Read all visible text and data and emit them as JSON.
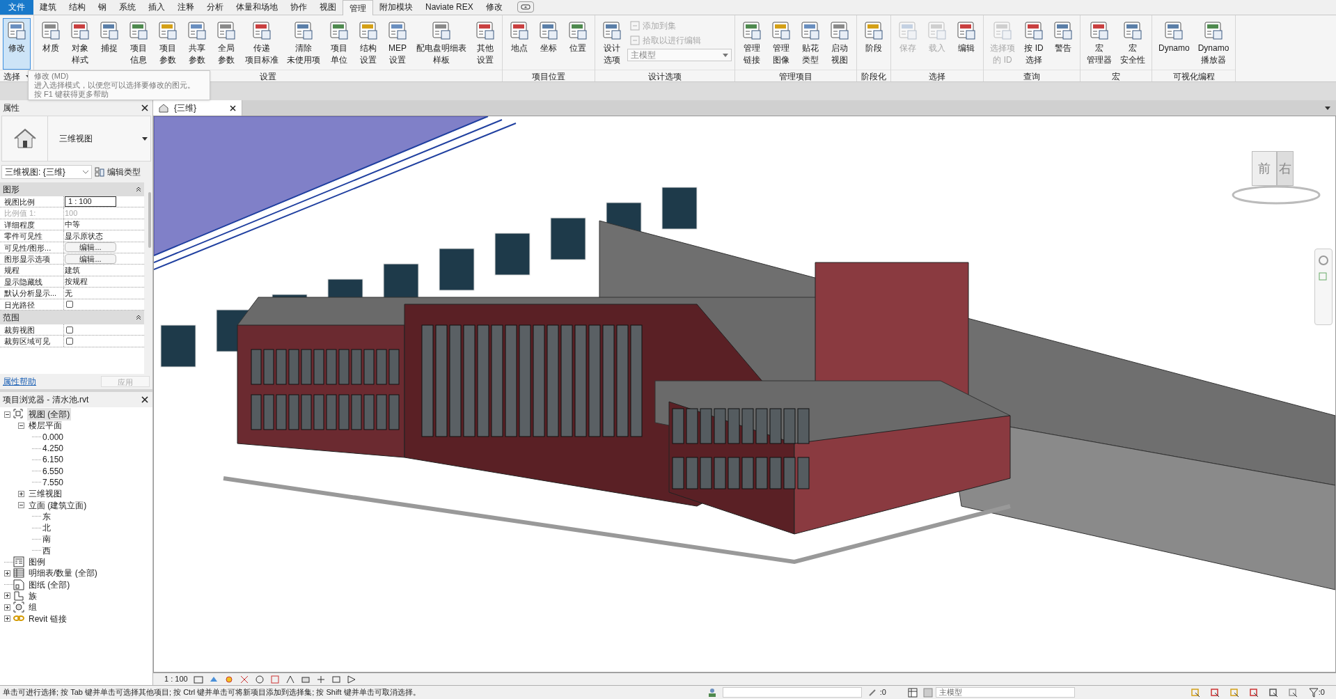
{
  "menu_tabs": [
    {
      "label": "文件",
      "kind": "file",
      "selected": false
    },
    {
      "label": "建筑",
      "kind": "tab",
      "selected": false
    },
    {
      "label": "结构",
      "kind": "tab",
      "selected": false
    },
    {
      "label": "钢",
      "kind": "tab",
      "selected": false
    },
    {
      "label": "系统",
      "kind": "tab",
      "selected": false
    },
    {
      "label": "插入",
      "kind": "tab",
      "selected": false
    },
    {
      "label": "注释",
      "kind": "tab",
      "selected": false
    },
    {
      "label": "分析",
      "kind": "tab",
      "selected": false
    },
    {
      "label": "体量和场地",
      "kind": "tab",
      "selected": false
    },
    {
      "label": "协作",
      "kind": "tab",
      "selected": false
    },
    {
      "label": "视图",
      "kind": "tab",
      "selected": false
    },
    {
      "label": "管理",
      "kind": "tab",
      "selected": true
    },
    {
      "label": "附加模块",
      "kind": "tab",
      "selected": false
    },
    {
      "label": "Naviate REX",
      "kind": "tab",
      "selected": false
    },
    {
      "label": "修改",
      "kind": "tab",
      "selected": false
    }
  ],
  "ribbon_panels": [
    {
      "label": "选择",
      "dropdown": true,
      "buttons": [
        {
          "lines": [
            "修改"
          ],
          "kind": "large",
          "selected": true,
          "disabled": false
        }
      ]
    },
    {
      "label": "设置",
      "dropdown": false,
      "buttons": [
        {
          "lines": [
            "材质"
          ],
          "kind": "large",
          "selected": false,
          "disabled": false
        },
        {
          "lines": [
            "对象",
            "样式"
          ],
          "kind": "large",
          "selected": false,
          "disabled": false
        },
        {
          "lines": [
            "捕捉"
          ],
          "kind": "large",
          "selected": false,
          "disabled": false
        },
        {
          "lines": [
            "项目",
            "信息"
          ],
          "kind": "large",
          "selected": false,
          "disabled": false
        },
        {
          "lines": [
            "项目",
            "参数"
          ],
          "kind": "large",
          "selected": false,
          "disabled": false
        },
        {
          "lines": [
            "共享",
            "参数"
          ],
          "kind": "large",
          "selected": false,
          "disabled": false
        },
        {
          "lines": [
            "全局",
            "参数"
          ],
          "kind": "large",
          "selected": false,
          "disabled": false
        },
        {
          "lines": [
            "传递",
            "项目标准"
          ],
          "kind": "large",
          "selected": false,
          "disabled": false
        },
        {
          "lines": [
            "清除",
            "未使用项"
          ],
          "kind": "large",
          "selected": false,
          "disabled": false
        },
        {
          "lines": [
            "项目",
            "单位"
          ],
          "kind": "large",
          "selected": false,
          "disabled": false
        },
        {
          "lines": [
            "结构",
            "设置"
          ],
          "kind": "large",
          "selected": false,
          "disabled": false
        },
        {
          "lines": [
            "MEP",
            "设置"
          ],
          "kind": "large",
          "selected": false,
          "disabled": false
        },
        {
          "lines": [
            "配电盘明细表",
            "样板"
          ],
          "kind": "large",
          "selected": false,
          "disabled": false
        },
        {
          "lines": [
            "其他",
            "设置"
          ],
          "kind": "large",
          "selected": false,
          "disabled": false
        }
      ]
    },
    {
      "label": "项目位置",
      "dropdown": false,
      "buttons": [
        {
          "lines": [
            "地点"
          ],
          "kind": "large",
          "selected": false,
          "disabled": false
        },
        {
          "lines": [
            "坐标"
          ],
          "kind": "large",
          "selected": false,
          "disabled": false
        },
        {
          "lines": [
            "位置"
          ],
          "kind": "large",
          "selected": false,
          "disabled": false
        }
      ]
    },
    {
      "label": "设计选项",
      "dropdown": false,
      "buttons": [
        {
          "lines": [
            "设计",
            "选项"
          ],
          "kind": "large",
          "selected": false,
          "disabled": false
        },
        {
          "lines": [
            "添加到集"
          ],
          "kind": "small",
          "disabled": true
        },
        {
          "lines": [
            "拾取以进行编辑"
          ],
          "kind": "small",
          "disabled": true
        },
        {
          "lines": [
            "主模型"
          ],
          "kind": "combo"
        }
      ]
    },
    {
      "label": "管理项目",
      "dropdown": false,
      "buttons": [
        {
          "lines": [
            "管理",
            "链接"
          ],
          "kind": "large",
          "selected": false,
          "disabled": false
        },
        {
          "lines": [
            "管理",
            "图像"
          ],
          "kind": "large",
          "selected": false,
          "disabled": false
        },
        {
          "lines": [
            "贴花",
            "类型"
          ],
          "kind": "large",
          "selected": false,
          "disabled": false
        },
        {
          "lines": [
            "启动",
            "视图"
          ],
          "kind": "large",
          "selected": false,
          "disabled": false
        }
      ]
    },
    {
      "label": "阶段化",
      "dropdown": false,
      "buttons": [
        {
          "lines": [
            "阶段"
          ],
          "kind": "large",
          "selected": false,
          "disabled": false
        }
      ]
    },
    {
      "label": "选择",
      "dropdown": false,
      "buttons": [
        {
          "lines": [
            "保存"
          ],
          "kind": "large",
          "selected": false,
          "disabled": true
        },
        {
          "lines": [
            "载入"
          ],
          "kind": "large",
          "selected": false,
          "disabled": true
        },
        {
          "lines": [
            "编辑"
          ],
          "kind": "large",
          "selected": false,
          "disabled": false
        }
      ]
    },
    {
      "label": "查询",
      "dropdown": false,
      "buttons": [
        {
          "lines": [
            "选择项",
            "的 ID"
          ],
          "kind": "large",
          "selected": false,
          "disabled": true
        },
        {
          "lines": [
            "按 ID",
            "选择"
          ],
          "kind": "large",
          "selected": false,
          "disabled": false
        },
        {
          "lines": [
            "警告"
          ],
          "kind": "large",
          "selected": false,
          "disabled": false
        }
      ]
    },
    {
      "label": "宏",
      "dropdown": false,
      "buttons": [
        {
          "lines": [
            "宏",
            "管理器"
          ],
          "kind": "large",
          "selected": false,
          "disabled": false
        },
        {
          "lines": [
            "宏",
            "安全性"
          ],
          "kind": "large",
          "selected": false,
          "disabled": false
        }
      ]
    },
    {
      "label": "可视化编程",
      "dropdown": false,
      "buttons": [
        {
          "lines": [
            "Dynamo"
          ],
          "kind": "large",
          "selected": false,
          "disabled": false
        },
        {
          "lines": [
            "Dynamo",
            "播放器"
          ],
          "kind": "large",
          "selected": false,
          "disabled": false
        }
      ]
    }
  ],
  "tooltip": {
    "title": "修改 (MD)",
    "text": "进入选择模式，以便您可以选择要修改的图元。",
    "help": "按 F1 键获得更多帮助"
  },
  "properties": {
    "title": "属性",
    "type_name": "三维视图",
    "selector": "三维视图: {三维}",
    "edit_type": "编辑类型",
    "sections": [
      {
        "label": "图形",
        "rows": [
          {
            "label": "视图比例",
            "value": "1 : 100",
            "kind": "input",
            "disabled": false
          },
          {
            "label": "比例值 1:",
            "value": "100",
            "kind": "text",
            "disabled": true
          },
          {
            "label": "详细程度",
            "value": "中等",
            "kind": "text",
            "disabled": false
          },
          {
            "label": "零件可见性",
            "value": "显示原状态",
            "kind": "text",
            "disabled": false
          },
          {
            "label": "可见性/图形...",
            "value": "编辑...",
            "kind": "button",
            "disabled": false
          },
          {
            "label": "图形显示选项",
            "value": "编辑...",
            "kind": "button",
            "disabled": false
          },
          {
            "label": "规程",
            "value": "建筑",
            "kind": "text",
            "disabled": false
          },
          {
            "label": "显示隐藏线",
            "value": "按规程",
            "kind": "text",
            "disabled": false
          },
          {
            "label": "默认分析显示...",
            "value": "无",
            "kind": "text",
            "disabled": false
          },
          {
            "label": "日光路径",
            "checked": false,
            "kind": "checkbox",
            "disabled": false
          }
        ]
      },
      {
        "label": "范围",
        "rows": [
          {
            "label": "裁剪视图",
            "checked": false,
            "kind": "checkbox",
            "disabled": false
          },
          {
            "label": "裁剪区域可见",
            "checked": false,
            "kind": "checkbox",
            "disabled": false
          }
        ]
      }
    ],
    "help_link": "属性帮助",
    "apply": "应用"
  },
  "project_browser": {
    "title": "项目浏览器 - 清水池.rvt",
    "tree": [
      {
        "label": "视图 (全部)",
        "expanded": true,
        "selected": true,
        "children": [
          {
            "label": "楼层平面",
            "expanded": true,
            "selected": false,
            "children": [
              {
                "label": "0.000",
                "selected": false
              },
              {
                "label": "4.250",
                "selected": false
              },
              {
                "label": "6.150",
                "selected": false
              },
              {
                "label": "6.550",
                "selected": false
              },
              {
                "label": "7.550",
                "selected": false
              }
            ]
          },
          {
            "label": "三维视图",
            "expanded": false,
            "selected": false
          },
          {
            "label": "立面 (建筑立面)",
            "expanded": true,
            "selected": false,
            "children": [
              {
                "label": "东",
                "selected": false
              },
              {
                "label": "北",
                "selected": false
              },
              {
                "label": "南",
                "selected": false
              },
              {
                "label": "西",
                "selected": false
              }
            ]
          }
        ]
      },
      {
        "label": "图例",
        "selected": false
      },
      {
        "label": "明细表/数量 (全部)",
        "expanded": false,
        "selected": false
      },
      {
        "label": "图纸 (全部)",
        "selected": false
      },
      {
        "label": "族",
        "expanded": false,
        "selected": false
      },
      {
        "label": "组",
        "expanded": false,
        "selected": false
      },
      {
        "label": "Revit 链接",
        "expanded": false,
        "selected": false
      }
    ]
  },
  "view_tab": {
    "title": "{三维}"
  },
  "viewcube": {
    "front": "前",
    "right": "右"
  },
  "view_control_bar": {
    "scale": "1 : 100"
  },
  "status_bar": {
    "message": "单击可进行选择; 按 Tab 键并单击可选择其他项目; 按 Ctrl 键并单击可将新项目添加到选择集; 按 Shift 键并单击可取消选择。",
    "worksets_count": ":0",
    "design_option": "主模型",
    "filter_count": ":0"
  }
}
